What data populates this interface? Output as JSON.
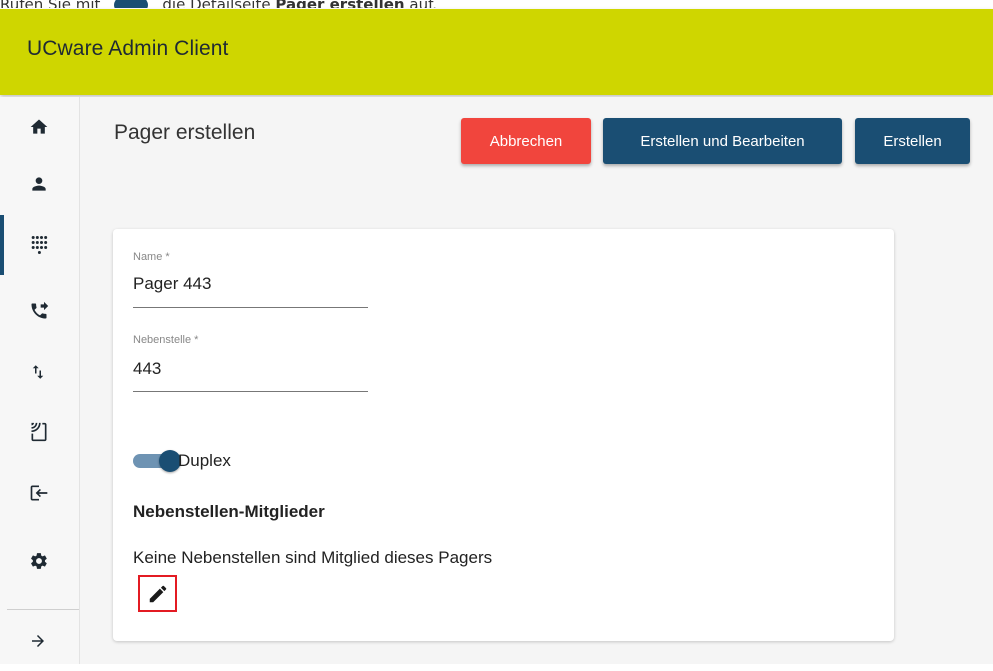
{
  "caption": {
    "prefix": "Rufen Sie mit",
    "middle": "die Detailseite",
    "bold": "Pager erstellen",
    "suffix": "auf."
  },
  "app": {
    "title": "UCware Admin Client",
    "bar_color": "#cfd600",
    "primary_color": "#1a4e73",
    "danger_color": "#f1453d"
  },
  "sidebar": {
    "items": [
      {
        "icon": "home-icon"
      },
      {
        "icon": "person-icon"
      },
      {
        "icon": "dialpad-icon",
        "active": true
      },
      {
        "icon": "phone-forward-icon"
      },
      {
        "icon": "swap-vert-icon"
      },
      {
        "icon": "cast-icon"
      },
      {
        "icon": "login-icon"
      },
      {
        "icon": "gear-icon"
      },
      {
        "icon": "arrow-right-icon"
      }
    ]
  },
  "page": {
    "title": "Pager erstellen",
    "buttons": {
      "cancel": "Abbrechen",
      "create_edit": "Erstellen und Bearbeiten",
      "create": "Erstellen"
    }
  },
  "form": {
    "name": {
      "label": "Name *",
      "value": "Pager 443"
    },
    "extension": {
      "label": "Nebenstelle *",
      "value": "443"
    },
    "duplex": {
      "label": "Duplex",
      "enabled": true
    },
    "members": {
      "title": "Nebenstellen-Mitglieder",
      "empty_text": "Keine Nebenstellen sind Mitglied dieses Pagers"
    }
  }
}
